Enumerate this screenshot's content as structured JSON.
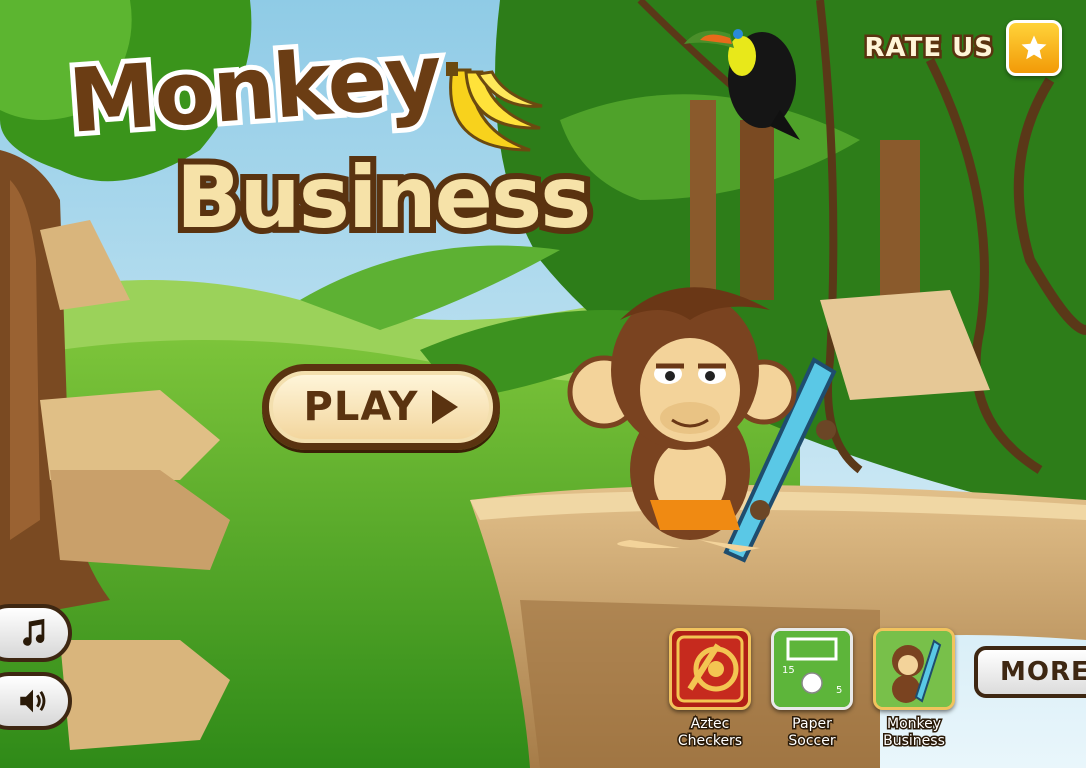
{
  "logo": {
    "line1": "Monkey",
    "line2": "Business"
  },
  "play_button": {
    "label": "PLAY"
  },
  "rate": {
    "label": "RATE US",
    "icon": "star-icon"
  },
  "sound_controls": {
    "music_icon": "music-note-icon",
    "sound_icon": "speaker-icon"
  },
  "promos": [
    {
      "name": "Aztec Checkers",
      "line1": "Aztec",
      "line2": "Checkers"
    },
    {
      "name": "Paper Soccer",
      "line1": "Paper",
      "line2": "Soccer"
    },
    {
      "name": "Monkey Business",
      "line1": "Monkey",
      "line2": "Business"
    }
  ],
  "more_button": {
    "label": "MORE"
  },
  "colors": {
    "brown": "#5a3310",
    "cream": "#f6e2a8",
    "jungle_green": "#3e9a1c",
    "sky": "#bfe3f2",
    "rock": "#d9b57c"
  }
}
